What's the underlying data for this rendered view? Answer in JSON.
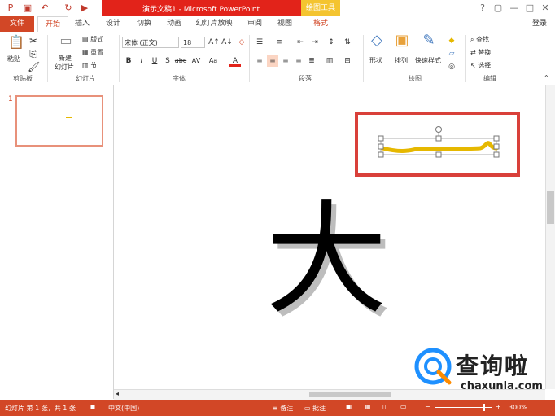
{
  "window": {
    "title": "演示文稿1 - Microsoft PowerPoint",
    "context_tab": "绘图工具",
    "login": "登录",
    "controls": [
      "?",
      "▢",
      "—",
      "□",
      "✕"
    ]
  },
  "tabs": [
    "文件",
    "开始",
    "插入",
    "设计",
    "切换",
    "动画",
    "幻灯片放映",
    "审阅",
    "视图",
    "格式"
  ],
  "ribbon": {
    "clipboard": {
      "paste": "粘贴",
      "label": "剪贴板"
    },
    "slides": {
      "new_slide_1": "新建",
      "new_slide_2": "幻灯片",
      "layout": "版式",
      "reset": "重置",
      "section": "节",
      "label": "幻灯片"
    },
    "font": {
      "name": "宋体 (正文)",
      "size": "18",
      "label": "字体",
      "bold": "B",
      "italic": "I",
      "underline": "U",
      "shadow": "S",
      "strike": "abc",
      "spacing": "AV",
      "case": "Aa",
      "color": "A"
    },
    "paragraph": {
      "label": "段落"
    },
    "drawing": {
      "shapes": "形状",
      "arrange": "排列",
      "quick_styles": "快速样式",
      "label": "绘图"
    },
    "editing": {
      "find": "查找",
      "replace": "替换",
      "select": "选择",
      "label": "编辑"
    }
  },
  "thumbnails": {
    "slide_number": "1"
  },
  "slide": {
    "char": "大"
  },
  "status": {
    "slide_info": "幻灯片 第 1 张，共 1 张",
    "language": "中文(中国)",
    "notes": "备注",
    "comments": "批注",
    "zoom": "300%"
  },
  "watermark": {
    "brand": "查询啦",
    "url": "chaxunla.com"
  },
  "colors": {
    "accent": "#d24726",
    "title_red": "#e2231a",
    "context_yellow": "#f4c430",
    "highlight_box": "#d9403a",
    "stroke": "#e6b800"
  }
}
